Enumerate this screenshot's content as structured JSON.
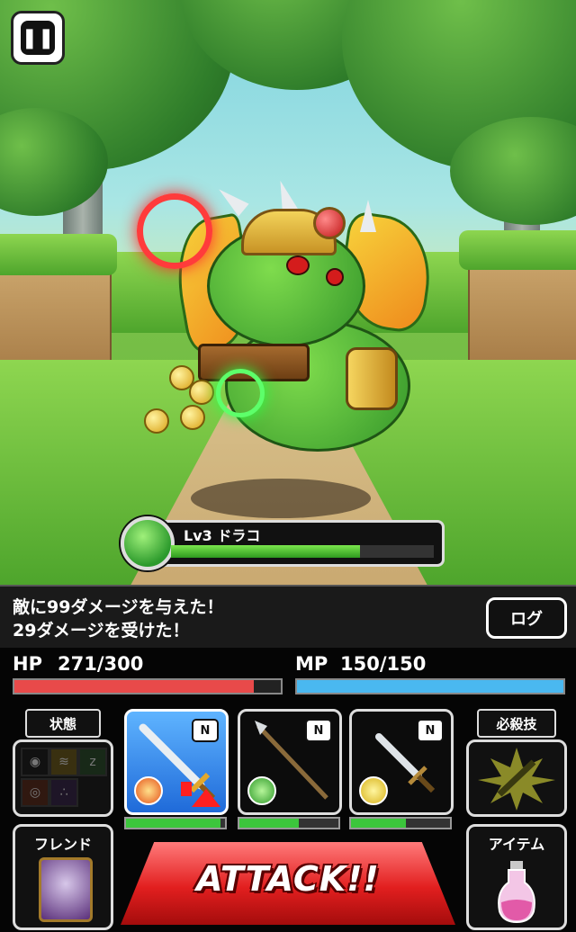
{
  "enemy": {
    "name": "Lv3 ドラコ",
    "hp_fraction": 0.72
  },
  "battle_log": {
    "line1": "敵に99ダメージを与えた！",
    "line2": "29ダメージを受けた！",
    "log_button": "ログ"
  },
  "player": {
    "hp_label": "HP",
    "hp_value": "271/300",
    "hp_fraction": 0.9,
    "mp_label": "MP",
    "mp_value": "150/150",
    "mp_fraction": 1.0
  },
  "panel": {
    "status_label": "状態",
    "special_label": "必殺技",
    "friend_label": "フレンド",
    "item_label": "アイテム",
    "attack_label": "ATTACK!!"
  },
  "weapons": [
    {
      "name": "sword",
      "badge": "N",
      "element": "fire",
      "gauge": 0.95,
      "selected": true
    },
    {
      "name": "spear",
      "badge": "N",
      "element": "wind",
      "gauge": 0.6,
      "selected": false
    },
    {
      "name": "dagger",
      "badge": "N",
      "element": "light",
      "gauge": 0.55,
      "selected": false
    }
  ],
  "colors": {
    "hp": "#e84a4a",
    "mp": "#4ab8f0",
    "attack": "#e21f1f",
    "selected_weapon": "#2a7ff0"
  }
}
